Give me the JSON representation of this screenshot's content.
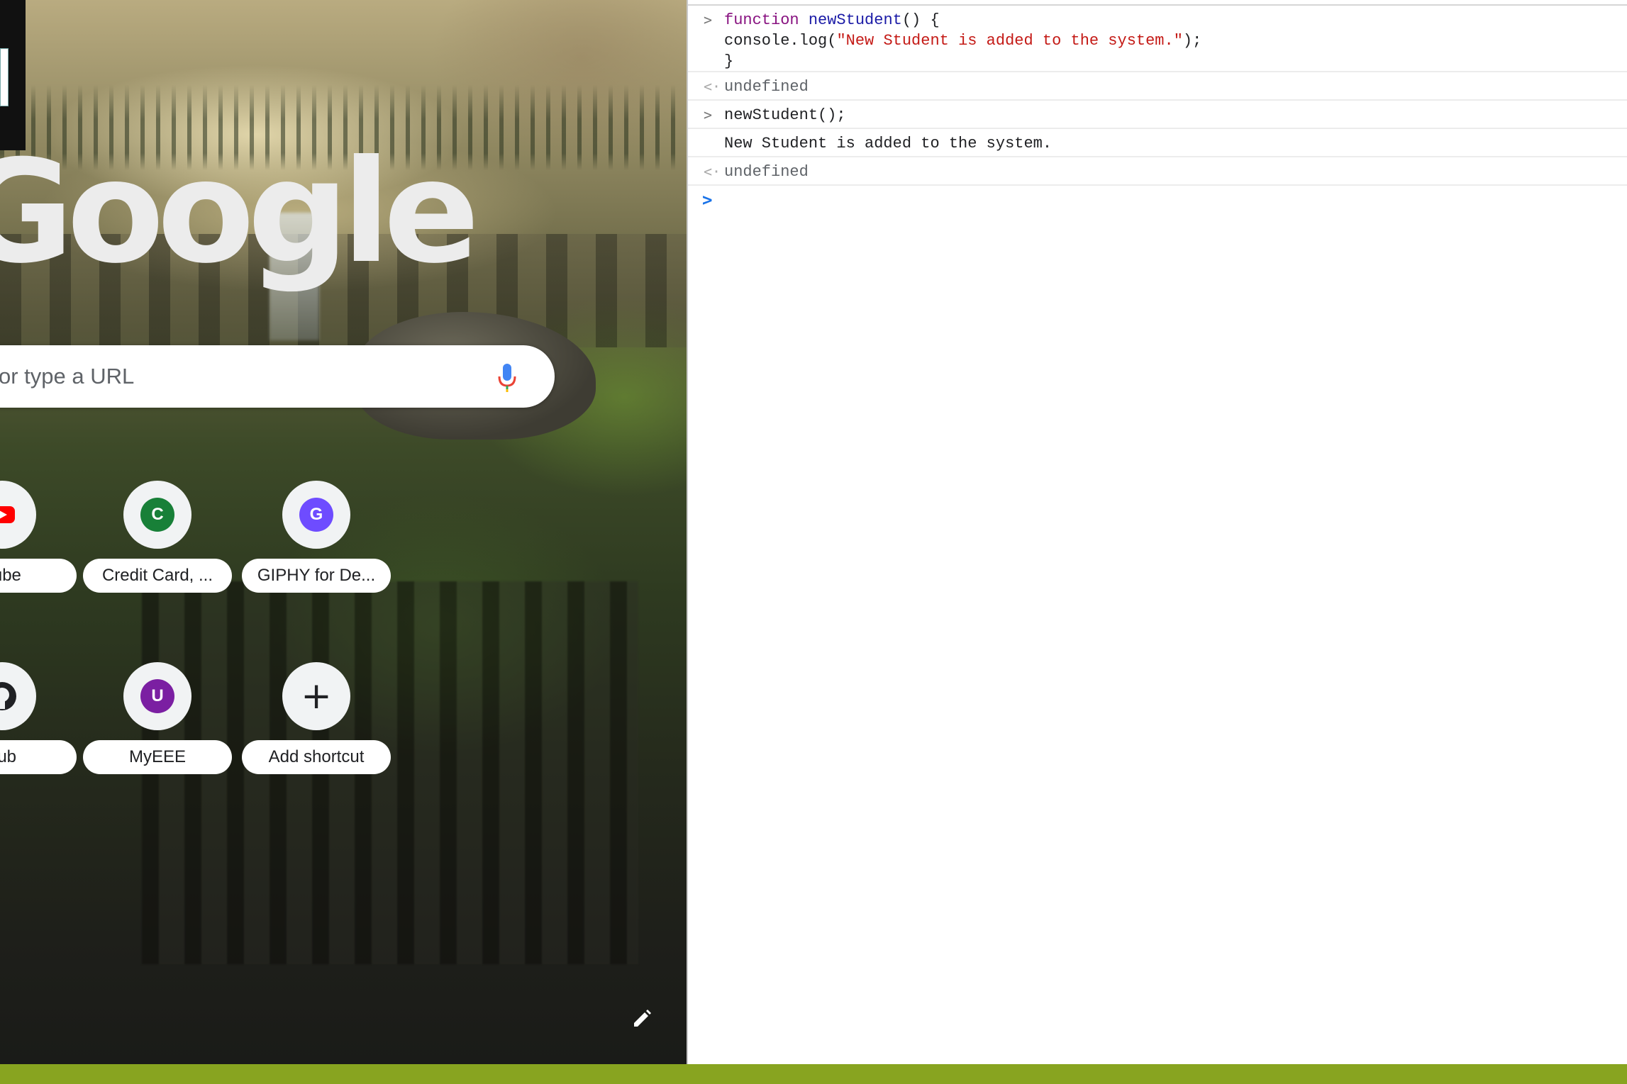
{
  "ntp": {
    "logo_text": "Google",
    "search": {
      "placeholder_visible": "or type a URL"
    },
    "shortcuts": [
      {
        "label": "Tube",
        "icon": "youtube-icon",
        "color": "#ff0000"
      },
      {
        "label": "Credit Card, ...",
        "icon": "C",
        "color": "#188038"
      },
      {
        "label": "GIPHY for De...",
        "icon": "G",
        "color": "#6e4cff"
      },
      {
        "label": "hub",
        "icon": "github-icon",
        "color": "#202124"
      },
      {
        "label": "MyEEE",
        "icon": "U",
        "color": "#7b1fa2"
      },
      {
        "label": "Add shortcut",
        "icon": "+",
        "color": "#202124"
      }
    ]
  },
  "console": {
    "entry1": {
      "line1_kw": "function",
      "line1_name": "newStudent",
      "line1_rest": "() {",
      "line2_pre": "console.log(",
      "line2_str": "\"New Student is added to the system.\"",
      "line2_post": ");",
      "line3": "}"
    },
    "result1": "undefined",
    "entry2": "newStudent();",
    "log_output": "New Student is added to the system.",
    "result2": "undefined"
  },
  "colors": {
    "taskbar": "#88a420",
    "prompt": "#1a73e8"
  }
}
